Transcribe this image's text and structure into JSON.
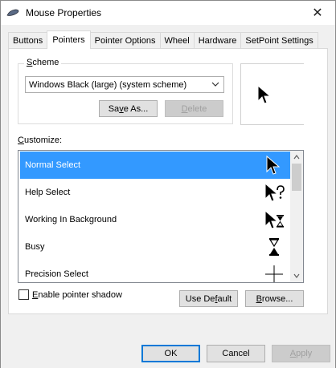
{
  "window": {
    "title": "Mouse Properties",
    "close_glyph": "✕"
  },
  "tabs": [
    {
      "label": "Buttons"
    },
    {
      "label": "Pointers"
    },
    {
      "label": "Pointer Options"
    },
    {
      "label": "Wheel"
    },
    {
      "label": "Hardware"
    },
    {
      "label": "SetPoint Settings"
    }
  ],
  "active_tab": "Pointers",
  "scheme": {
    "label_first": "S",
    "label_rest": "cheme",
    "selected": "Windows Black (large) (system scheme)",
    "save_as_pre": "Sa",
    "save_as_u": "v",
    "save_as_post": "e As...",
    "delete_u": "D",
    "delete_rest": "elete"
  },
  "customize": {
    "label_first": "C",
    "label_rest": "ustomize:",
    "items": [
      {
        "label": "Normal Select",
        "icon": "arrow-cursor-icon",
        "selected": true
      },
      {
        "label": "Help Select",
        "icon": "help-cursor-icon",
        "selected": false
      },
      {
        "label": "Working In Background",
        "icon": "working-cursor-icon",
        "selected": false
      },
      {
        "label": "Busy",
        "icon": "hourglass-icon",
        "selected": false
      },
      {
        "label": "Precision Select",
        "icon": "crosshair-icon",
        "selected": false
      }
    ]
  },
  "shadow": {
    "label_first": "E",
    "label_rest": "nable pointer shadow",
    "checked": false
  },
  "buttons": {
    "use_default_pre": "Use De",
    "use_default_u": "f",
    "use_default_post": "ault",
    "browse_u": "B",
    "browse_rest": "rowse...",
    "ok": "OK",
    "cancel": "Cancel",
    "apply_u": "A",
    "apply_rest": "pply"
  },
  "colors": {
    "selection": "#3399ff",
    "focus_border": "#0078d7"
  }
}
